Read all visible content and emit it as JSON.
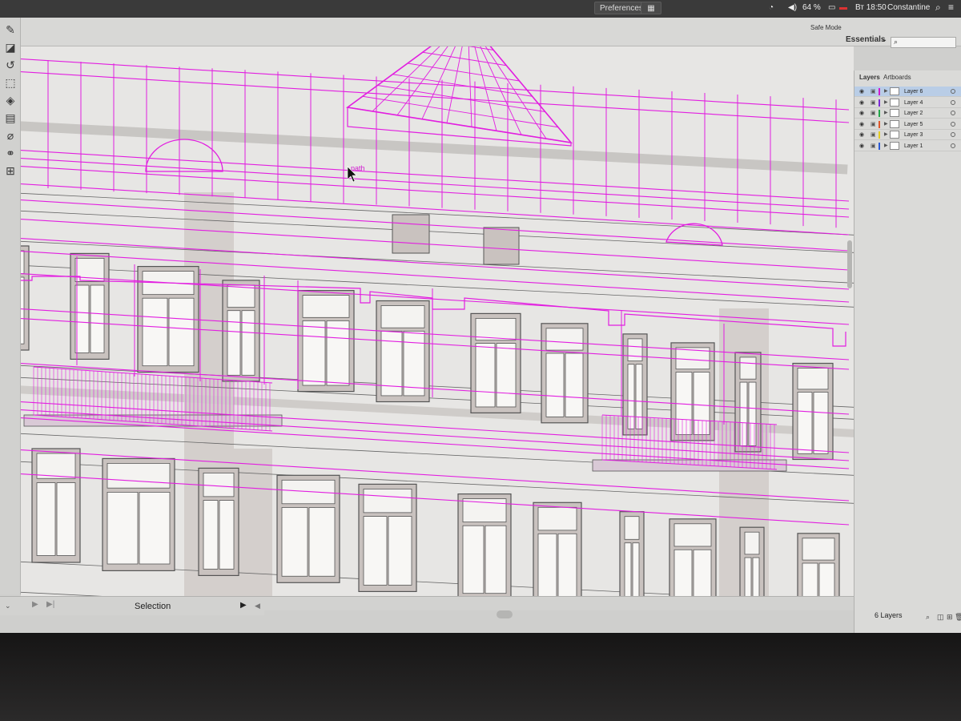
{
  "appbar": {
    "preferences_label": "Preferences",
    "battery": "64 %",
    "clock": "Вт 18:50",
    "user": "Constantine"
  },
  "workbar": {
    "safe_mode": "Safe Mode",
    "workspace": "Essentials",
    "search_placeholder": ""
  },
  "canvas": {
    "hover_label": "path"
  },
  "layers_panel": {
    "tabs": [
      "Layers",
      "Artboards"
    ],
    "layers": [
      {
        "name": "Layer 6",
        "color": "#d11bd1",
        "active": true
      },
      {
        "name": "Layer 4",
        "color": "#7b2ad6",
        "active": false
      },
      {
        "name": "Layer 2",
        "color": "#22a64a",
        "active": false
      },
      {
        "name": "Layer 5",
        "color": "#e0582a",
        "active": false
      },
      {
        "name": "Layer 3",
        "color": "#e4cc22",
        "active": false
      },
      {
        "name": "Layer 1",
        "color": "#2a5ad6",
        "active": false
      }
    ],
    "count_label": "6 Layers"
  },
  "statusbar": {
    "tool_name": "Selection"
  },
  "colors": {
    "guides": "#e21ee0",
    "ink": "#555555",
    "window_fill": "#c9c2bf",
    "canvas_bg": "#e7e6e4"
  }
}
